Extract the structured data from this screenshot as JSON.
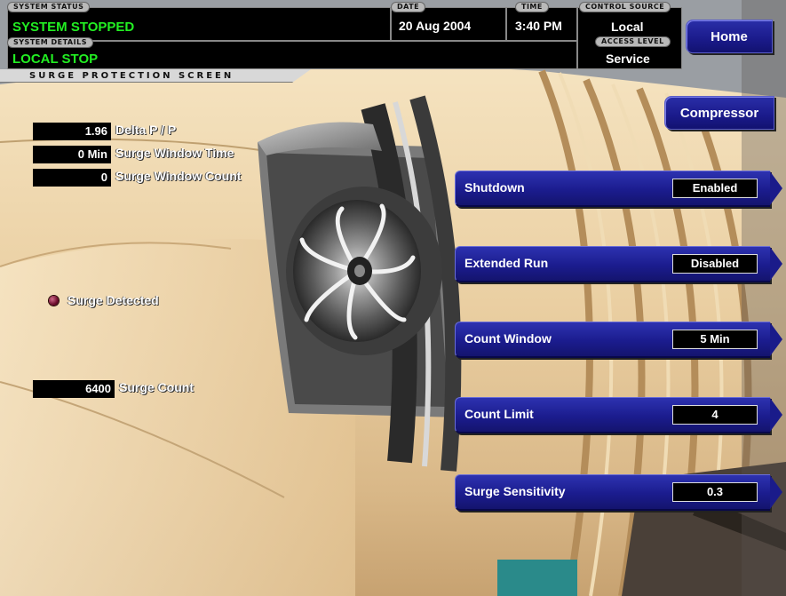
{
  "header": {
    "system_status_label": "SYSTEM STATUS",
    "system_status": "SYSTEM STOPPED",
    "system_details_label": "SYSTEM DETAILS",
    "system_details": "LOCAL STOP",
    "date_label": "DATE",
    "date": "20 Aug 2004",
    "time_label": "TIME",
    "time": "3:40 PM",
    "control_source_label": "CONTROL SOURCE",
    "control_source": "Local",
    "access_level_label": "ACCESS LEVEL",
    "access_level": "Service"
  },
  "screen_title": "SURGE PROTECTION SCREEN",
  "nav": {
    "home": "Home",
    "compressor": "Compressor"
  },
  "readouts": [
    {
      "value": "1.96",
      "label": "Delta P / P"
    },
    {
      "value": "0 Min",
      "label": "Surge Window Time"
    },
    {
      "value": "0",
      "label": "Surge Window Count"
    }
  ],
  "surge_detected": {
    "label": "Surge Detected",
    "state": "off",
    "led_color": "#7a0a30"
  },
  "surge_count": {
    "value": "6400",
    "label": "Surge Count"
  },
  "parameters": [
    {
      "label": "Shutdown",
      "value": "Enabled"
    },
    {
      "label": "Extended Run",
      "value": "Disabled"
    },
    {
      "label": "Count Window",
      "value": "5 Min"
    },
    {
      "label": "Count Limit",
      "value": "4"
    },
    {
      "label": "Surge Sensitivity",
      "value": "0.3"
    }
  ],
  "colors": {
    "status_green": "#22ee22",
    "button_blue": "#1b1c8e",
    "casing_tan": "#e8cfa4"
  }
}
